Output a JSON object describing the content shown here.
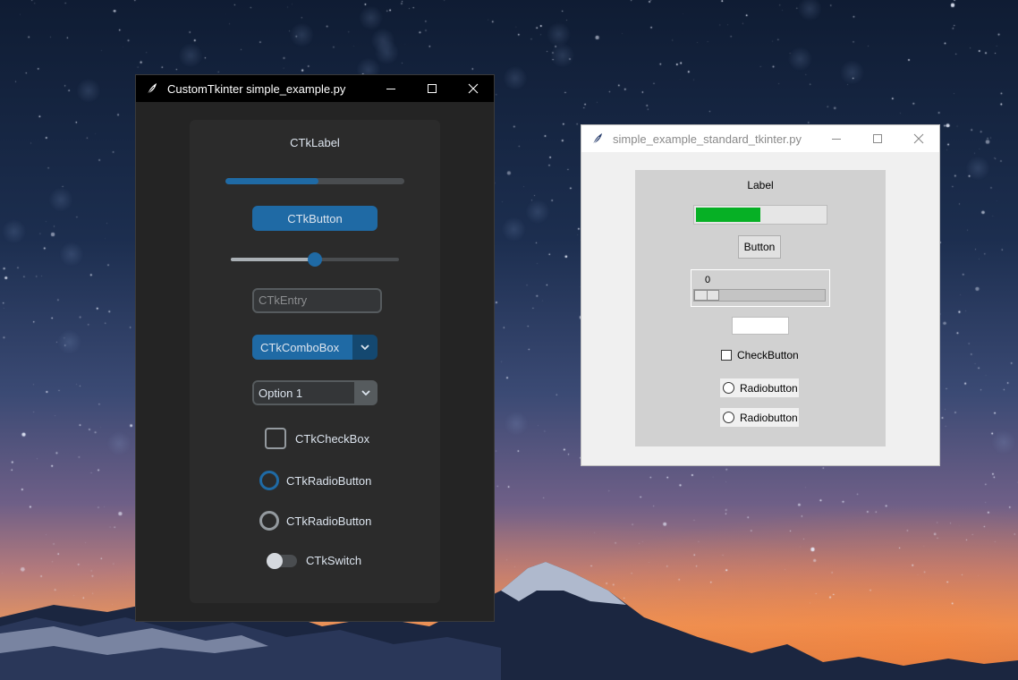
{
  "ctk_window": {
    "title": "CustomTkinter simple_example.py",
    "label": "CTkLabel",
    "progress": 0.52,
    "button": "CTkButton",
    "slider_value": 0.5,
    "entry_placeholder": "CTkEntry",
    "combobox_value": "CTkComboBox",
    "option_menu_value": "Option 1",
    "checkbox_label": "CTkCheckBox",
    "radio_1_label": "CTkRadioButton",
    "radio_2_label": "CTkRadioButton",
    "switch_label": "CTkSwitch",
    "colors": {
      "accent": "#1f6aa5",
      "accent_dark": "#144870",
      "window_bg": "#242424",
      "frame_bg": "#2b2b2b"
    }
  },
  "tk_window": {
    "title": "simple_example_standard_tkinter.py",
    "label": "Label",
    "progress": 0.5,
    "button": "Button",
    "scale_value": "0",
    "entry_value": "",
    "checkbutton_label": "CheckButton",
    "radio_1_label": "Radiobutton",
    "radio_2_label": "Radiobutton",
    "colors": {
      "progress_green": "#06b025",
      "frame_bg": "#d1d1d1"
    }
  }
}
